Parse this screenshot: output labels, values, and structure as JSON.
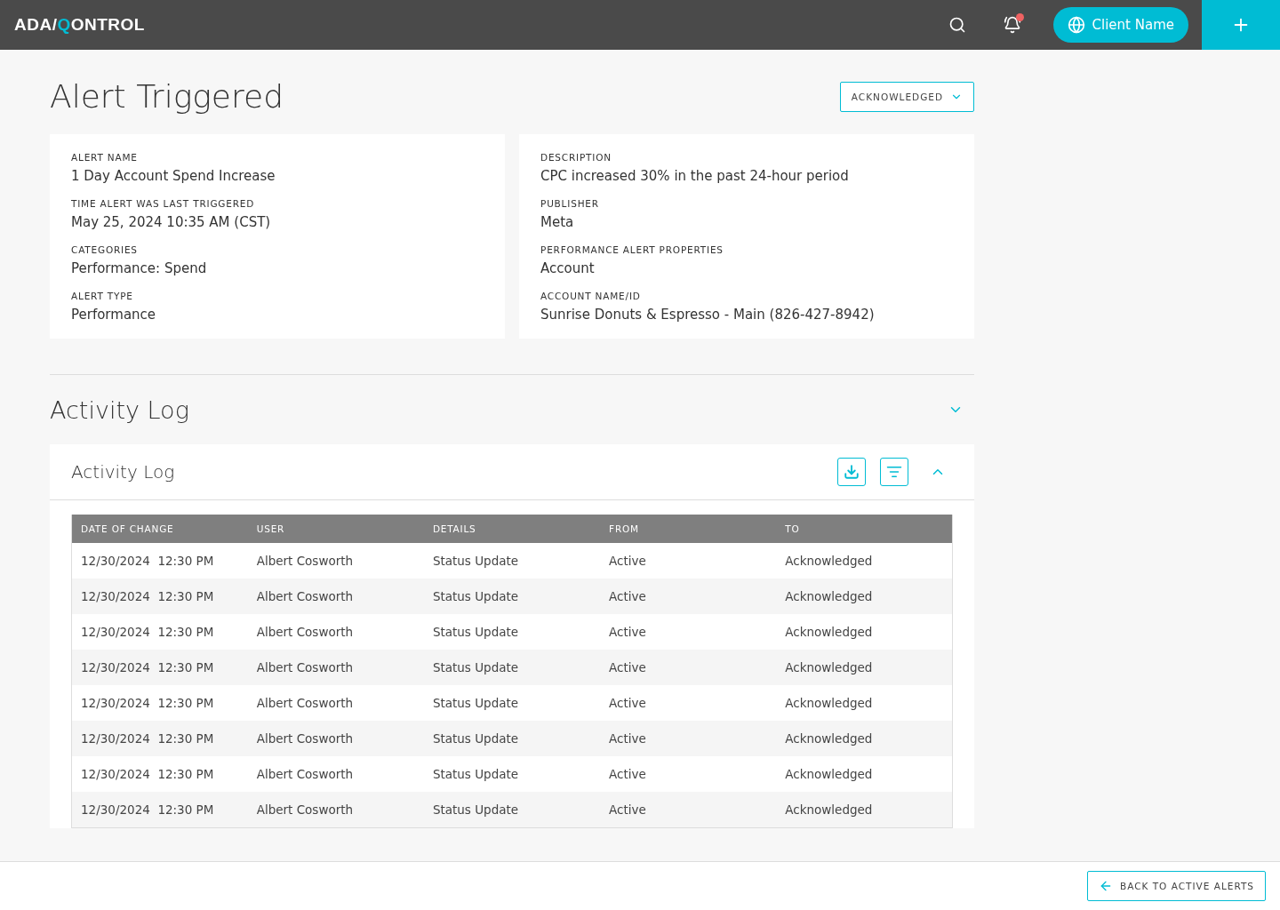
{
  "header": {
    "logo": {
      "prefix": "ADA/",
      "mark": "Q",
      "suffix": "ONTROL"
    },
    "notifications": {
      "unread": true
    },
    "client_button": "Client Name"
  },
  "page": {
    "title": "Alert Triggered",
    "status_dropdown": "ACKNOWLEDGED"
  },
  "details_left": [
    {
      "label": "ALERT NAME",
      "value": "1 Day Account Spend Increase"
    },
    {
      "label": "TIME ALERT WAS LAST TRIGGERED",
      "value": "May 25, 2024 10:35 AM (CST)"
    },
    {
      "label": "CATEGORIES",
      "value": "Performance: Spend"
    },
    {
      "label": "ALERT TYPE",
      "value": "Performance"
    }
  ],
  "details_right": [
    {
      "label": "DESCRIPTION",
      "value": "CPC increased 30% in the past 24-hour period"
    },
    {
      "label": "PUBLISHER",
      "value": "Meta"
    },
    {
      "label": "PERFORMANCE ALERT PROPERTIES",
      "value": "Account"
    },
    {
      "label": "ACCOUNT NAME/ID",
      "value": "Sunrise Donuts & Espresso - Main (826-427-8942)"
    }
  ],
  "activity_section": {
    "title": "Activity Log",
    "expanded": true
  },
  "activity_card": {
    "title": "Activity Log",
    "expanded": true
  },
  "table": {
    "columns": [
      "DATE OF CHANGE",
      "USER",
      "DETAILS",
      "FROM",
      "TO"
    ],
    "rows": [
      [
        "12/30/2024  12:30 PM",
        "Albert Cosworth",
        "Status Update",
        "Active",
        "Acknowledged"
      ],
      [
        "12/30/2024  12:30 PM",
        "Albert Cosworth",
        "Status Update",
        "Active",
        "Acknowledged"
      ],
      [
        "12/30/2024  12:30 PM",
        "Albert Cosworth",
        "Status Update",
        "Active",
        "Acknowledged"
      ],
      [
        "12/30/2024  12:30 PM",
        "Albert Cosworth",
        "Status Update",
        "Active",
        "Acknowledged"
      ],
      [
        "12/30/2024  12:30 PM",
        "Albert Cosworth",
        "Status Update",
        "Active",
        "Acknowledged"
      ],
      [
        "12/30/2024  12:30 PM",
        "Albert Cosworth",
        "Status Update",
        "Active",
        "Acknowledged"
      ],
      [
        "12/30/2024  12:30 PM",
        "Albert Cosworth",
        "Status Update",
        "Active",
        "Acknowledged"
      ],
      [
        "12/30/2024  12:30 PM",
        "Albert Cosworth",
        "Status Update",
        "Active",
        "Acknowledged"
      ]
    ]
  },
  "footer": {
    "back_button": "BACK TO ACTIVE ALERTS"
  }
}
